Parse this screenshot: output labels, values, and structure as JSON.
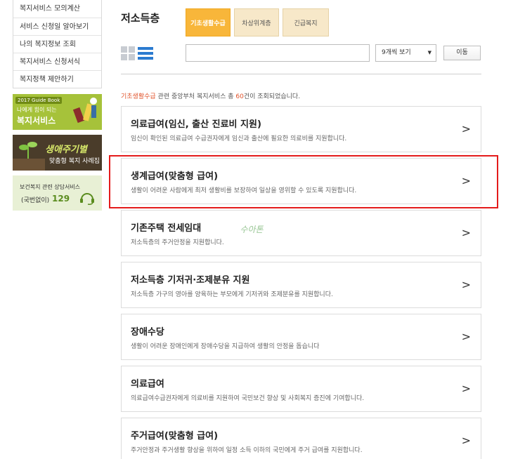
{
  "sidebar": {
    "items": [
      {
        "label": "복지서비스 모의계산"
      },
      {
        "label": "서비스 신청일 알아보기"
      },
      {
        "label": "나의 복지정보 조회"
      },
      {
        "label": "복지서비스 신청서식"
      },
      {
        "label": "복지정책 제안하기"
      }
    ],
    "banners": [
      {
        "tag": "2017 Guide Book",
        "line1": "나에게 힘이 되는",
        "line2": "복지서비스"
      },
      {
        "line1": "생애주기별",
        "line2": "맞춤형 복지 사례집"
      },
      {
        "line1": "보건복지 관련 상담서비스",
        "line2": "(국번없이)",
        "number": "129"
      }
    ]
  },
  "header": {
    "title": "저소득층",
    "tabs": [
      {
        "label": "기초생활수급",
        "active": true
      },
      {
        "label": "차상위계층",
        "active": false
      },
      {
        "label": "긴급복지",
        "active": false
      }
    ]
  },
  "search": {
    "value": "",
    "placeholder": "",
    "select_value": "9개씩 보기",
    "button_label": "이동"
  },
  "result": {
    "category": "기초생활수급",
    "prefix": " 관련 중앙부처 복지서비스 총 ",
    "count": "60",
    "suffix": "건이 조회되었습니다."
  },
  "stamp": {
    "text": "수아톤"
  },
  "cards": [
    {
      "title": "의료급여(임신, 출산 진료비 지원)",
      "desc": "임신이 확인된 의료급여 수급권자에게 임신과 출산에 필요한 의료비를 지원합니다."
    },
    {
      "title": "생계급여(맞춤형 급여)",
      "desc": "생활이 어려운 사람에게 최저 생활비를 보장하여 일상을 영위할 수 있도록 지원합니다."
    },
    {
      "title": "기존주택 전세임대",
      "desc": "저소득층의 주거안정을 지원합니다."
    },
    {
      "title": "저소득층 기저귀·조제분유 지원",
      "desc": "저소득층 가구의 영아를 양육하는 부모에게 기저귀와 조제분유를 지원합니다."
    },
    {
      "title": "장애수당",
      "desc": "생활이 어려운 장애인에게 장애수당을 지급하여 생활의 안정을 돕습니다"
    },
    {
      "title": "의료급여",
      "desc": "의료급여수급권자에게 의료비를 지원하여 국민보건 향상 및 사회복지 증진에 기여합니다."
    },
    {
      "title": "주거급여(맞춤형 급여)",
      "desc": "주거안정과 주거생활 향상을 위하여 일정 소득 이하의 국민에게 주거 급여를 지원합니다."
    }
  ],
  "colors": {
    "accent_tab": "#f8b63a",
    "tab_inactive": "#f7e8c9",
    "highlight": "#e0522a",
    "annotation_box": "#e41b1b",
    "list_icon": "#2b7bd0"
  }
}
